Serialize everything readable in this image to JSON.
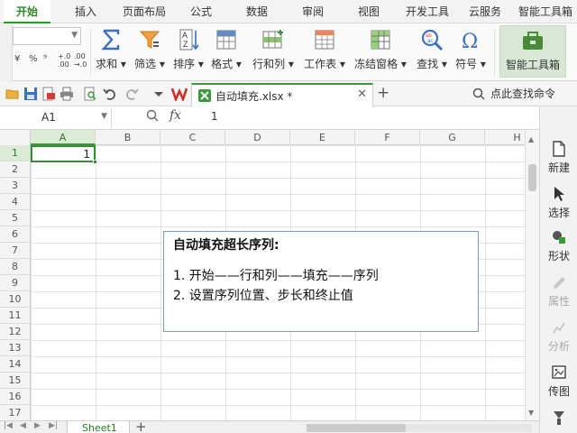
{
  "menubar": {
    "tabs": [
      "开始",
      "插入",
      "页面布局",
      "公式",
      "数据",
      "审阅",
      "视图",
      "开发工具",
      "云服务",
      "智能工具箱"
    ],
    "active_index": 0
  },
  "ribbon": {
    "numfmt": [
      "¥",
      "%",
      "⁹",
      "+.0 .00",
      ".00 →.0"
    ],
    "buttons": [
      {
        "label": "求和 ▾",
        "icon": "sigma-icon"
      },
      {
        "label": "筛选 ▾",
        "icon": "funnel-icon"
      },
      {
        "label": "排序 ▾",
        "icon": "sort-az-icon"
      },
      {
        "label": "格式 ▾",
        "icon": "format-grid-icon"
      },
      {
        "label": "行和列 ▾",
        "icon": "rows-cols-icon"
      },
      {
        "label": "工作表 ▾",
        "icon": "worksheet-icon"
      },
      {
        "label": "冻结窗格 ▾",
        "icon": "freeze-panes-icon"
      },
      {
        "label": "查找 ▾",
        "icon": "find-icon"
      },
      {
        "label": "符号 ▾",
        "icon": "omega-icon"
      },
      {
        "label": "智能工具箱",
        "icon": "toolbox-icon"
      }
    ]
  },
  "quickbar": {
    "doc_tab": "自动填充.xlsx *",
    "search_cmd": "点此查找命令"
  },
  "formulabar": {
    "cell_ref": "A1",
    "fx": "fx",
    "content": "1"
  },
  "grid": {
    "columns": [
      "A",
      "B",
      "C",
      "D",
      "E",
      "F",
      "G",
      "H"
    ],
    "rows": [
      "1",
      "2",
      "3",
      "4",
      "5",
      "6",
      "7",
      "8",
      "9",
      "10",
      "11",
      "12",
      "13",
      "14",
      "15",
      "16",
      "17"
    ],
    "selected_cell": "A1",
    "a1_value": "1"
  },
  "note": {
    "title": "自动填充超长序列:",
    "line1": "1. 开始——行和列——填充——序列",
    "line2": "2. 设置序列位置、步长和终止值"
  },
  "sheetbar": {
    "sheet_name": "Sheet1"
  },
  "rightpane": {
    "items": [
      {
        "label": "新建",
        "enabled": true
      },
      {
        "label": "选择",
        "enabled": true
      },
      {
        "label": "形状",
        "enabled": true
      },
      {
        "label": "属性",
        "enabled": false
      },
      {
        "label": "分析",
        "enabled": false
      },
      {
        "label": "传图",
        "enabled": true
      }
    ]
  },
  "colors": {
    "accent": "#3a9a3a",
    "selection": "#dcebd6",
    "note_border": "#7a9cc6"
  }
}
